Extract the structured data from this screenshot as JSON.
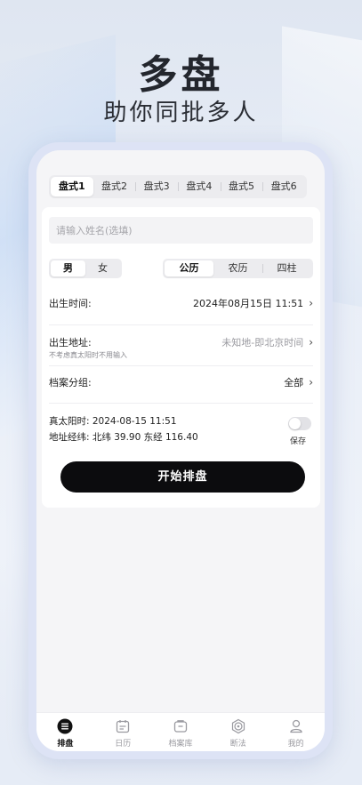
{
  "promo": {
    "title": "多盘",
    "subtitle": "助你同批多人"
  },
  "tabs": [
    {
      "label": "盘式1",
      "active": true
    },
    {
      "label": "盘式2",
      "active": false
    },
    {
      "label": "盘式3",
      "active": false
    },
    {
      "label": "盘式4",
      "active": false
    },
    {
      "label": "盘式5",
      "active": false
    },
    {
      "label": "盘式6",
      "active": false
    }
  ],
  "form": {
    "name_placeholder": "请输入姓名(选填)",
    "gender": {
      "options": [
        "男",
        "女"
      ],
      "selected": "男"
    },
    "calendar": {
      "options": [
        "公历",
        "农历",
        "四柱"
      ],
      "selected": "公历"
    },
    "birth_time_label": "出生时间:",
    "birth_time_value": "2024年08月15日 11:51",
    "birth_place_label": "出生地址:",
    "birth_place_value": "未知地-即北京时间",
    "birth_place_hint": "不考虑真太阳时不用输入",
    "group_label": "档案分组:",
    "group_value": "全部",
    "solar_time": "真太阳时: 2024-08-15 11:51",
    "coords": "地址经纬: 北纬 39.90 东经 116.40",
    "save_label": "保存",
    "save_toggle_on": false,
    "start_button": "开始排盘"
  },
  "tabbar": [
    {
      "label": "排盘",
      "icon": "list-icon",
      "active": true
    },
    {
      "label": "日历",
      "icon": "calendar-icon",
      "active": false
    },
    {
      "label": "档案库",
      "icon": "archive-icon",
      "active": false
    },
    {
      "label": "断法",
      "icon": "compass-icon",
      "active": false
    },
    {
      "label": "我的",
      "icon": "user-icon",
      "active": false
    }
  ]
}
